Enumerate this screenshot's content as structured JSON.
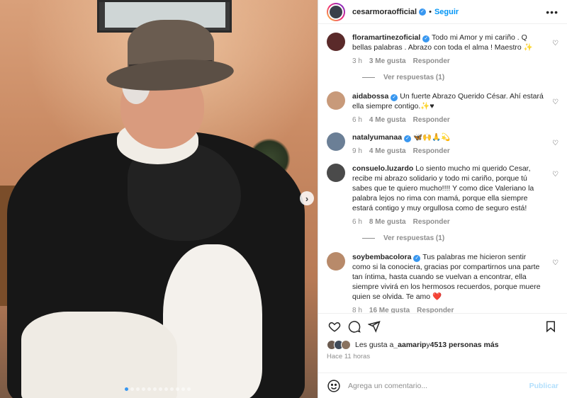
{
  "post": {
    "author": "cesarmoraofficial",
    "follow_label": "Seguir",
    "more_icon": "more-horizontal-icon",
    "carousel_dots": 12,
    "carousel_active": 0
  },
  "comments": [
    {
      "user": "floramartinezoficial",
      "verified": true,
      "text": "Todo mi Amor y mi cariño . Q bellas palabras . Abrazo con toda el alma ! Maestro ✨",
      "time": "3 h",
      "likes": "3 Me gusta",
      "reply": "Responder",
      "avatar_color": "#5a2a2a",
      "replies_label": "Ver respuestas (1)"
    },
    {
      "user": "aidabossa",
      "verified": true,
      "text": "Un fuerte Abrazo Querido César. Ahí estará ella siempre contigo.✨♥",
      "time": "6 h",
      "likes": "4 Me gusta",
      "reply": "Responder",
      "avatar_color": "#c89a7a"
    },
    {
      "user": "natalyumanaa",
      "verified": true,
      "text": "🦋🙌🙏💫",
      "time": "9 h",
      "likes": "4 Me gusta",
      "reply": "Responder",
      "avatar_color": "#6b7f96"
    },
    {
      "user": "consuelo.luzardo",
      "verified": false,
      "text": "Lo siento mucho mi querido Cesar, recibe mi abrazo solidario y todo mi cariño, porque tú sabes que te quiero mucho!!!! Y como dice Valeriano la palabra lejos no rima con mamá, porque ella siempre estará contigo y muy orgullosa como de seguro está!",
      "time": "6 h",
      "likes": "8 Me gusta",
      "reply": "Responder",
      "avatar_color": "#4a4a4a",
      "replies_label": "Ver respuestas (1)"
    },
    {
      "user": "soybembacolora",
      "verified": true,
      "text": "Tus palabras me hicieron sentir como si la conociera, gracias por compartirnos una parte tan íntima, hasta cuando se vuelvan a encontrar, ella siempre vivirá en los hermosos recuerdos, porque muere quien se olvida. Te amo ❤️",
      "time": "8 h",
      "likes": "16 Me gusta",
      "reply": "Responder",
      "avatar_color": "#b88a6a"
    }
  ],
  "likes_line": {
    "prefix": "Les gusta a ",
    "user": "_aamarip",
    "middle": " y ",
    "count": "4513 personas más"
  },
  "posted_ago": "Hace 11 horas",
  "composer": {
    "placeholder": "Agrega un comentario...",
    "publish_label": "Publicar"
  },
  "colors": {
    "accent": "#0095f6",
    "verified": "#3897f0",
    "muted": "#8e8e8e"
  }
}
